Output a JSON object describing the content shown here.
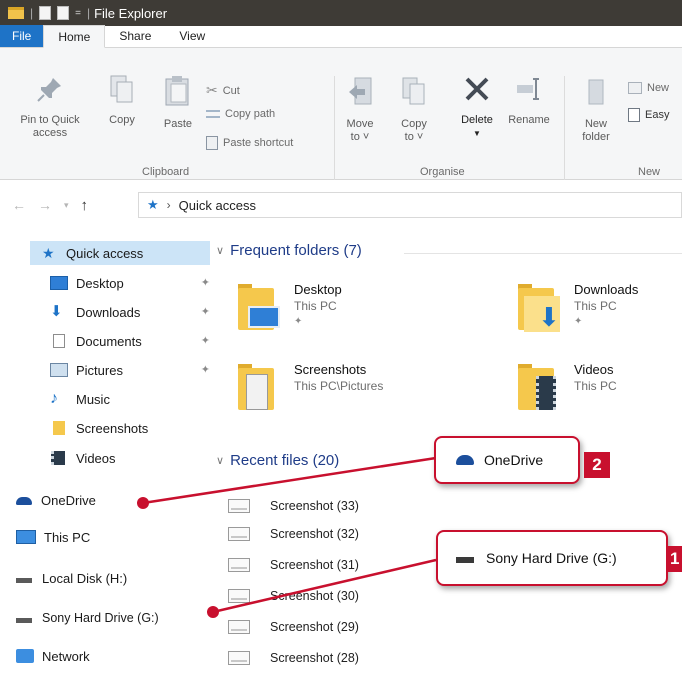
{
  "window": {
    "title": "File Explorer"
  },
  "tabs": [
    {
      "label": "File"
    },
    {
      "label": "Home"
    },
    {
      "label": "Share"
    },
    {
      "label": "View"
    }
  ],
  "ribbon": {
    "clipboard": {
      "pin": "Pin to Quick",
      "pin2": "access",
      "copy": "Copy",
      "paste": "Paste",
      "cut": "Cut",
      "copy_path": "Copy path",
      "paste_shortcut": "Paste shortcut",
      "group": "Clipboard"
    },
    "organise": {
      "move": "Move",
      "move2": "to",
      "copy": "Copy",
      "copy2": "to",
      "delete": "Delete",
      "rename": "Rename",
      "group": "Organise"
    },
    "new": {
      "new_folder": "New",
      "new_folder2": "folder",
      "new_item": "New",
      "easy": "Easy",
      "group": "New"
    }
  },
  "address": {
    "crumb": "Quick access"
  },
  "nav": {
    "quick_access": "Quick access",
    "items": [
      {
        "label": "Desktop",
        "pinned": "true"
      },
      {
        "label": "Downloads",
        "pinned": "true"
      },
      {
        "label": "Documents",
        "pinned": "true"
      },
      {
        "label": "Pictures",
        "pinned": "true"
      },
      {
        "label": "Music"
      },
      {
        "label": "Screenshots"
      },
      {
        "label": "Videos"
      }
    ],
    "onedrive": "OneDrive",
    "this_pc": "This PC",
    "local_disk": "Local Disk (H:)",
    "sony": "Sony Hard Drive (G:)",
    "network": "Network"
  },
  "frequent": {
    "header": "Frequent folders (7)",
    "tiles": [
      {
        "name": "Desktop",
        "sub": "This PC"
      },
      {
        "name": "Downloads",
        "sub": "This PC"
      },
      {
        "name": "Screenshots",
        "sub": "This PC\\Pictures"
      },
      {
        "name": "Videos",
        "sub": "This PC"
      }
    ]
  },
  "recent": {
    "header": "Recent files (20)",
    "files": [
      "Screenshot (33)",
      "Screenshot (32)",
      "Screenshot (31)",
      "Screenshot (30)",
      "Screenshot (29)",
      "Screenshot (28)"
    ]
  },
  "callouts": [
    {
      "label": "OneDrive",
      "number": "2"
    },
    {
      "label": "Sony Hard Drive (G:)",
      "number": "1"
    }
  ],
  "colors": {
    "accent": "#1e73c7",
    "callout": "#c8102e",
    "selection": "#cce4f7"
  }
}
